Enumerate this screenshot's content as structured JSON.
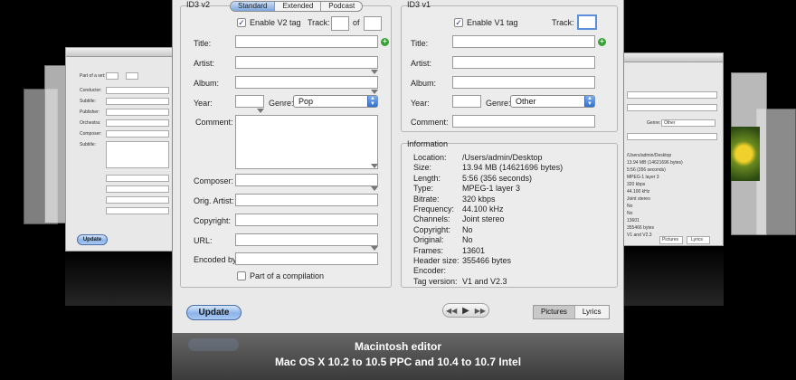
{
  "left_window": {
    "labels": [
      "Part of a set:",
      "Conductor:",
      "Subtitle:",
      "Publisher:",
      "Orchestra:",
      "Composer:",
      "Subtitle:"
    ],
    "update_label": "Update"
  },
  "right_window": {
    "lines": [
      "/Users/admin/Desktop",
      "13.94 MB (14621696 bytes)",
      "5:56 (356 seconds)",
      "MPEG-1 layer 3",
      "320 kbps",
      "44.100 kHz",
      "Joint stereo",
      "No",
      "No",
      "13601",
      "355466 bytes",
      "",
      "V1 and V2.3"
    ],
    "genre_label": "Genre:",
    "genre_value": "Other",
    "pictures_label": "Pictures",
    "lyrics_label": "Lyrics"
  },
  "id3v2": {
    "title": "ID3 v2",
    "tabs": [
      "Standard",
      "Extended",
      "Podcast"
    ],
    "enable_label": "Enable V2 tag",
    "enabled": true,
    "track_label": "Track:",
    "track_value": "",
    "of_label": "of",
    "of_value": "",
    "fields": {
      "title": {
        "label": "Title:",
        "value": ""
      },
      "artist": {
        "label": "Artist:",
        "value": ""
      },
      "album": {
        "label": "Album:",
        "value": ""
      },
      "year": {
        "label": "Year:",
        "value": ""
      },
      "genre": {
        "label": "Genre:",
        "value": "Pop"
      },
      "comment": {
        "label": "Comment:",
        "value": ""
      },
      "composer": {
        "label": "Composer:",
        "value": ""
      },
      "orig_artist": {
        "label": "Orig. Artist:",
        "value": ""
      },
      "copyright": {
        "label": "Copyright:",
        "value": ""
      },
      "url": {
        "label": "URL:",
        "value": ""
      },
      "encoded_by": {
        "label": "Encoded by:",
        "value": ""
      }
    },
    "compilation_label": "Part of a compilation",
    "compilation_checked": false
  },
  "id3v1": {
    "title": "ID3 v1",
    "enable_label": "Enable V1 tag",
    "enabled": true,
    "track_label": "Track:",
    "track_value": "",
    "fields": {
      "title": {
        "label": "Title:",
        "value": ""
      },
      "artist": {
        "label": "Artist:",
        "value": ""
      },
      "album": {
        "label": "Album:",
        "value": ""
      },
      "year": {
        "label": "Year:",
        "value": ""
      },
      "genre": {
        "label": "Genre:",
        "value": "Other"
      },
      "comment": {
        "label": "Comment:",
        "value": ""
      }
    }
  },
  "information": {
    "title": "Information",
    "rows": [
      {
        "key": "Location:",
        "value": "/Users/admin/Desktop"
      },
      {
        "key": "Size:",
        "value": "13.94 MB (14621696 bytes)"
      },
      {
        "key": "Length:",
        "value": "5:56 (356 seconds)"
      },
      {
        "key": "Type:",
        "value": "MPEG-1 layer 3"
      },
      {
        "key": "Bitrate:",
        "value": "320 kbps"
      },
      {
        "key": "Frequency:",
        "value": "44.100 kHz"
      },
      {
        "key": "Channels:",
        "value": "Joint stereo"
      },
      {
        "key": "Copyright:",
        "value": "No"
      },
      {
        "key": "Original:",
        "value": "No"
      },
      {
        "key": "Frames:",
        "value": "13601"
      },
      {
        "key": "Header size:",
        "value": "355466 bytes"
      },
      {
        "key": "Encoder:",
        "value": ""
      },
      {
        "key": "Tag version:",
        "value": "V1 and V2.3"
      }
    ]
  },
  "bottom": {
    "update_label": "Update",
    "player": {
      "prev": "◀◀",
      "play": "▶",
      "next": "▶▶"
    },
    "toggle": [
      "Pictures",
      "Lyrics"
    ],
    "toggle_active": "Pictures"
  },
  "caption": {
    "line1": "Macintosh editor",
    "line2": "Mac OS X 10.2 to 10.5 PPC and 10.4 to 10.7 Intel"
  },
  "colors": {
    "accent": "#7fa7dd",
    "background": "#000000"
  }
}
